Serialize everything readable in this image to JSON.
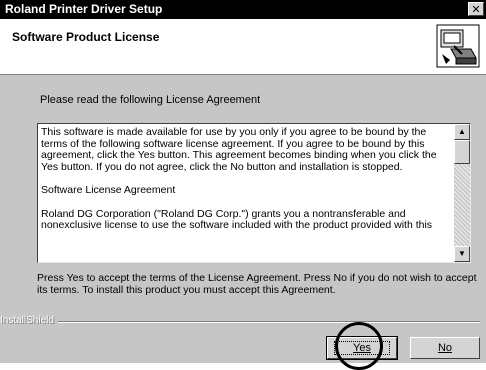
{
  "window": {
    "title": "Roland Printer Driver Setup",
    "close_glyph": "✕"
  },
  "header": {
    "title": "Software Product License",
    "icon": "printer-install-icon"
  },
  "instructions": "Please read the following License Agreement",
  "license": {
    "paragraphs": [
      "This software is made available for use by you only if you agree to be bound by the terms of the following software license agreement. If you agree to be bound by this agreement, click the Yes button. This agreement becomes binding when you click the Yes button. If you do not agree, click the No button and installation is stopped.",
      "Software License Agreement",
      "Roland DG Corporation (\"Roland DG Corp.\") grants you a nontransferable and nonexclusive license to use the software included with the product provided with this"
    ]
  },
  "scrollbar": {
    "up_glyph": "▲",
    "down_glyph": "▼"
  },
  "accept_text": "Press Yes to accept the terms of the License Agreement. Press No if you do not wish to accept its terms.  To install this product you must accept this Agreement.",
  "installshield_label": "InstallShield",
  "buttons": {
    "yes": "Yes",
    "no": "No"
  }
}
